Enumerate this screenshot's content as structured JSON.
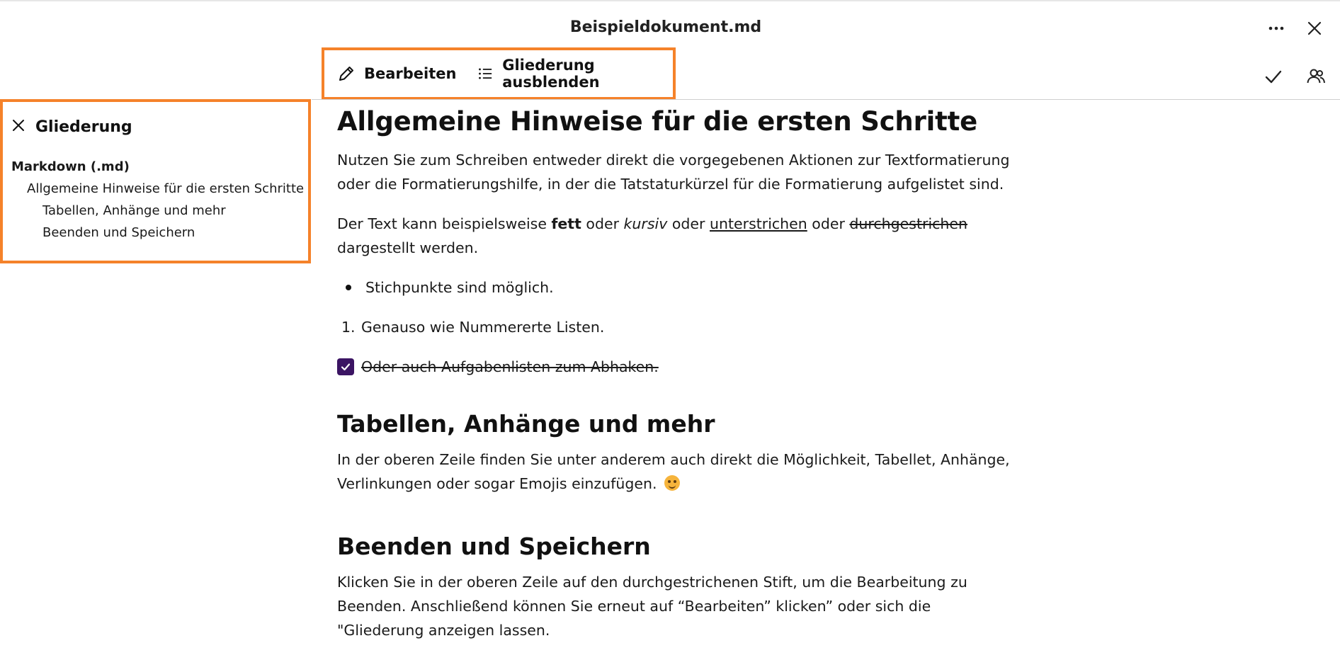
{
  "window": {
    "title": "Beispieldokument.md",
    "more_icon": "more-horizontal-icon",
    "close_icon": "close-icon"
  },
  "toolbar": {
    "edit_label": "Bearbeiten",
    "edit_icon": "pencil-icon",
    "outline_toggle_label": "Gliederung ausblenden",
    "outline_toggle_icon": "list-icon",
    "check_icon": "checkmark-icon",
    "people_icon": "people-icon",
    "highlight_color": "#f5822a"
  },
  "outline": {
    "header": "Gliederung",
    "items": [
      {
        "level": 0,
        "label": "Markdown (.md)"
      },
      {
        "level": 1,
        "label": "Allgemeine Hinweise für die ersten Schritte"
      },
      {
        "level": 2,
        "label": "Tabellen, Anhänge und mehr"
      },
      {
        "level": 2,
        "label": "Beenden und Speichern"
      }
    ]
  },
  "document": {
    "h1": "Allgemeine Hinweise für die ersten Schritte",
    "p1": "Nutzen Sie zum Schreiben entweder direkt die vorgegebenen Aktionen zur Textformatierung oder die Formatierungshilfe, in der die Tatstaturkürzel für die Formatierung aufgelistet sind.",
    "p2": {
      "t1": "Der Text kann beispielsweise ",
      "bold": "fett",
      "t2": " oder ",
      "italic": "kursiv",
      "t3": " oder ",
      "underline": "unterstrichen",
      "t4": " oder ",
      "strike": "durchgestrichen",
      "t5": " dargestellt werden."
    },
    "bullet": "Stichpunkte sind möglich.",
    "numbered_num": "1.",
    "numbered": "Genauso wie Nummererte Listen.",
    "task": "Oder auch Aufgabenlisten zum Abhaken.",
    "task_checked": true,
    "checkbox_color": "#3b1463",
    "h2_tables": "Tabellen, Anhänge und mehr",
    "p3": "In der oberen Zeile finden Sie unter anderem auch direkt die Möglichkeit, Tabellet, Anhänge, Verlinkungen oder sogar Emojis einzufügen.",
    "emoji_icon": "smiley-emoji-icon",
    "h2_finish": "Beenden und Speichern",
    "p4": "Klicken Sie in der oberen Zeile auf den durchgestrichenen Stift, um die Bearbeitung zu Beenden. Anschließend können Sie erneut auf “Bearbeiten” klicken” oder sich die \"Gliederung anzeigen lassen."
  }
}
